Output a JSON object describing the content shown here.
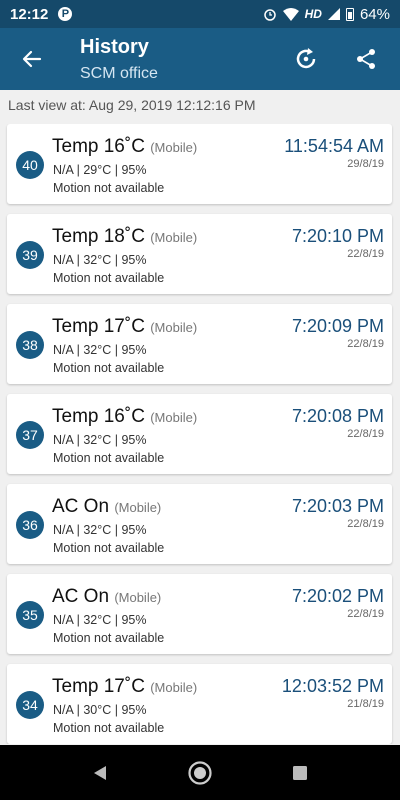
{
  "status_bar": {
    "time": "12:12",
    "p_label": "P",
    "hd": "HD",
    "battery": "64%"
  },
  "header": {
    "title": "History",
    "subtitle": "SCM office"
  },
  "last_view": "Last view at: Aug 29, 2019 12:12:16 PM",
  "events": [
    {
      "num": "40",
      "title": "Temp 16˚C",
      "source": "(Mobile)",
      "details": "N/A  |  29°C  |  95%",
      "motion": "Motion not available",
      "time": "11:54:54 AM",
      "date": "29/8/19"
    },
    {
      "num": "39",
      "title": "Temp 18˚C",
      "source": "(Mobile)",
      "details": "N/A  |  32°C  |  95%",
      "motion": "Motion not available",
      "time": "7:20:10 PM",
      "date": "22/8/19"
    },
    {
      "num": "38",
      "title": "Temp 17˚C",
      "source": "(Mobile)",
      "details": "N/A  |  32°C  |  95%",
      "motion": "Motion not available",
      "time": "7:20:09 PM",
      "date": "22/8/19"
    },
    {
      "num": "37",
      "title": "Temp 16˚C",
      "source": "(Mobile)",
      "details": "N/A  |  32°C  |  95%",
      "motion": "Motion not available",
      "time": "7:20:08 PM",
      "date": "22/8/19"
    },
    {
      "num": "36",
      "title": "AC On",
      "source": "(Mobile)",
      "details": "N/A  |  32°C  |  95%",
      "motion": "Motion not available",
      "time": "7:20:03 PM",
      "date": "22/8/19"
    },
    {
      "num": "35",
      "title": "AC On",
      "source": "(Mobile)",
      "details": "N/A  |  32°C  |  95%",
      "motion": "Motion not available",
      "time": "7:20:02 PM",
      "date": "22/8/19"
    },
    {
      "num": "34",
      "title": "Temp 17˚C",
      "source": "(Mobile)",
      "details": "N/A  |  30°C  |  95%",
      "motion": "Motion not available",
      "time": "12:03:52 PM",
      "date": "21/8/19"
    }
  ],
  "icons": {
    "back": "arrow-back-icon",
    "refresh": "refresh-icon",
    "share": "share-icon"
  },
  "colors": {
    "status_bar": "#15496a",
    "app_bar": "#1a5c85",
    "badge": "#1a5c85",
    "time_text": "#1a4f7a"
  }
}
